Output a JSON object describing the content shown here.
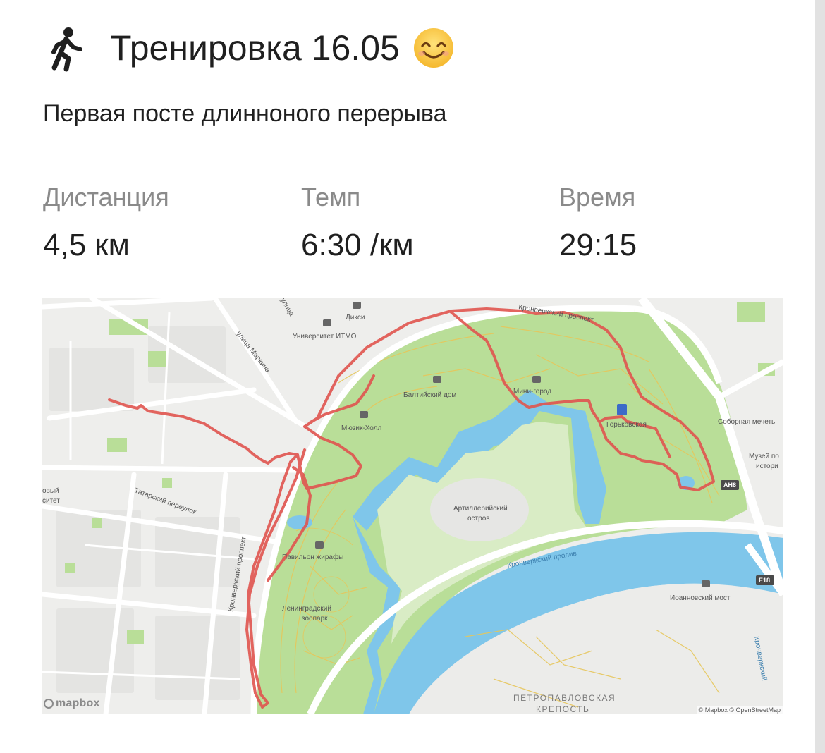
{
  "header": {
    "title": "Тренировка 16.05",
    "run_icon": "running-person-icon",
    "emoji": "smiling-face-emoji"
  },
  "description": "Первая посте длинноного перерыва",
  "stats": [
    {
      "label": "Дистанция",
      "value": "4,5 км"
    },
    {
      "label": "Темп",
      "value": "6:30 /км"
    },
    {
      "label": "Время",
      "value": "29:15"
    }
  ],
  "map": {
    "labels": {
      "dixy": "Дикси",
      "itmo": "Университет ИТМО",
      "markina": "улица Маркина",
      "ulitsa": "улица",
      "kronverksky_top": "Кронверкский проспект",
      "baltic_house": "Балтийский дом",
      "music_hall": "Мюзик-Холл",
      "mini_city": "Мини-город",
      "gorkovskaya": "Горьковская",
      "mosque": "Соборная мечеть",
      "museum": "Музей по",
      "museum_2": "истори",
      "artillery": "Артиллерийский",
      "artillery_2": "остров",
      "giraffe": "Павильон жирафы",
      "zoo": "Ленинградский",
      "zoo_2": "зоопарк",
      "tatarsky": "Татарский переулок",
      "kronverksky_left": "Кронверкский проспект",
      "kronverksky_strait": "Кронверкский пролив",
      "ioannovsky": "Иоанновский мост",
      "fortress": "ПЕТРОПАВЛОВСКАЯ",
      "fortress_2": "КРЕПОСТЬ",
      "left_cut": "овый",
      "left_cut_2": "ситет",
      "ah8": "AH8",
      "e18": "E18",
      "kronverksky_right": "Кронверкский"
    },
    "logo": "mapbox",
    "attribution": "© Mapbox © OpenStreetMap",
    "route_color": "#e0544f",
    "park_color": "#b9de98",
    "water_color": "#7fc6ea"
  }
}
